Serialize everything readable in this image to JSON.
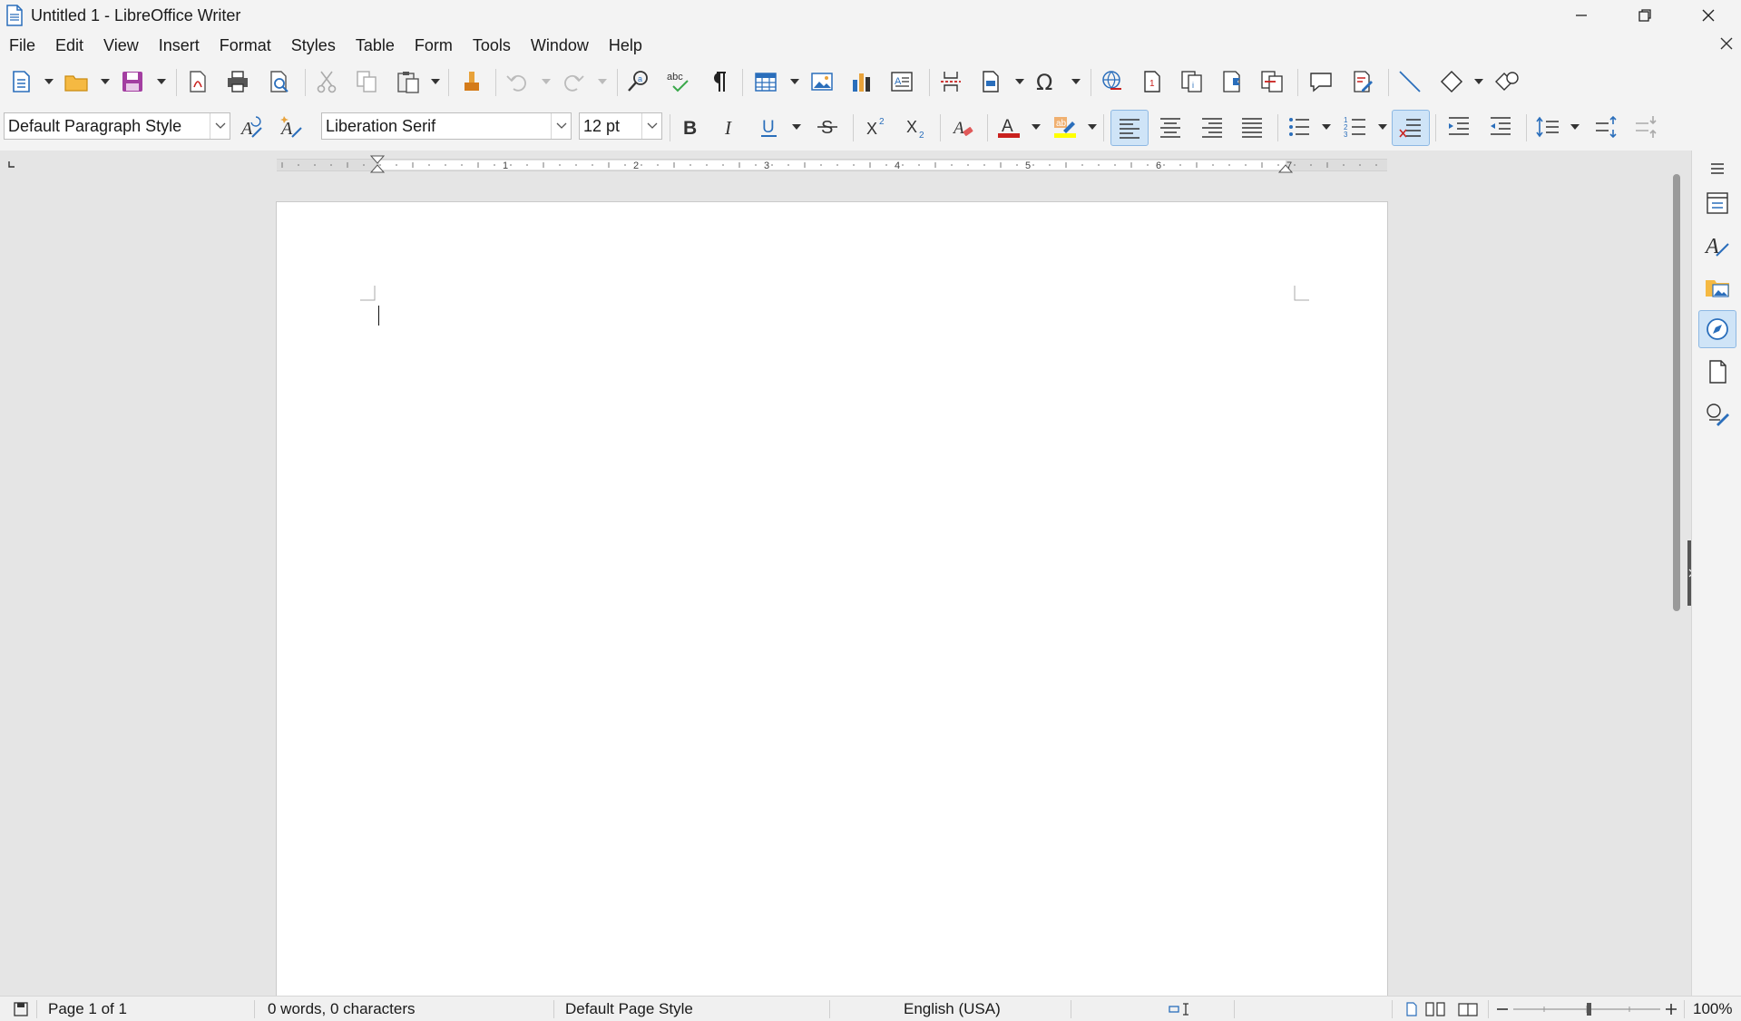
{
  "window": {
    "title": "Untitled 1 - LibreOffice Writer"
  },
  "menu": [
    "File",
    "Edit",
    "View",
    "Insert",
    "Format",
    "Styles",
    "Table",
    "Form",
    "Tools",
    "Window",
    "Help"
  ],
  "formatting": {
    "paragraph_style": "Default Paragraph Style",
    "font_name": "Liberation Serif",
    "font_size": "12 pt"
  },
  "ruler": {
    "numbers": [
      "1",
      "2",
      "3",
      "4",
      "5",
      "6",
      "7"
    ]
  },
  "statusbar": {
    "page": "Page 1 of 1",
    "words": "0 words, 0 characters",
    "page_style": "Default Page Style",
    "language": "English (USA)",
    "zoom": "100%"
  },
  "colors": {
    "accent": "#2a6ebb",
    "font_color_bar": "#c9211e",
    "highlight_bar": "#ffff00",
    "active_button_bg": "#cfe4f7"
  },
  "icons": {
    "toolbar1": [
      "new-document-icon",
      "open-icon",
      "save-icon",
      "export-pdf-icon",
      "print-icon",
      "print-preview-icon",
      "cut-icon",
      "copy-icon",
      "paste-icon",
      "clone-formatting-icon",
      "undo-icon",
      "redo-icon",
      "find-replace-icon",
      "spelling-icon",
      "formatting-marks-icon",
      "insert-table-icon",
      "insert-image-icon",
      "insert-chart-icon",
      "insert-textbox-icon",
      "page-break-icon",
      "insert-field-icon",
      "special-character-icon",
      "hyperlink-icon",
      "footnote-icon",
      "endnote-icon",
      "bookmark-icon",
      "cross-reference-icon",
      "comment-icon",
      "track-changes-icon",
      "line-icon",
      "basic-shapes-icon",
      "draw-functions-icon"
    ],
    "sidebar": [
      "properties-icon",
      "styles-icon",
      "gallery-icon",
      "navigator-icon",
      "page-icon",
      "manage-changes-icon"
    ]
  }
}
